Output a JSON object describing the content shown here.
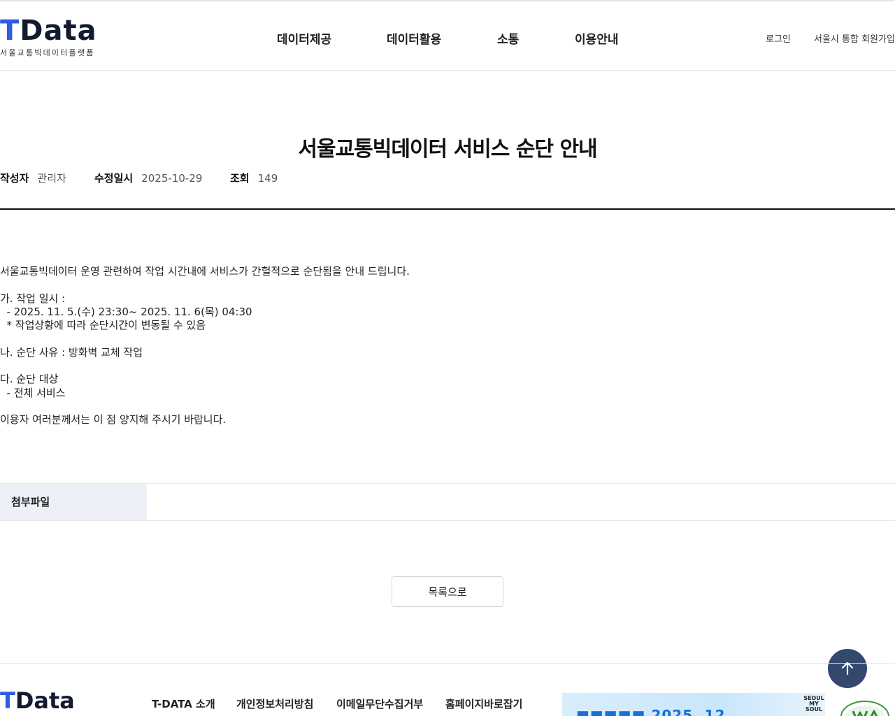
{
  "header": {
    "logo_t": "T",
    "logo_rest": "Data",
    "logo_sub": "서울교통빅데이터플랫폼",
    "nav": [
      "데이터제공",
      "데이터활용",
      "소통",
      "이용안내"
    ],
    "login": "로그인",
    "signup": "서울시 통합 회원가입"
  },
  "post": {
    "title": "서울교통빅데이터 서비스 순단 안내",
    "author_label": "작성자",
    "author": "관리자",
    "modified_label": "수정일시",
    "modified": "2025-10-29",
    "views_label": "조회",
    "views": "149",
    "body_lines": [
      "서울교통빅데이터 운영 관련하여 작업 시간내에 서비스가 간헐적으로 순단됨을 안내 드립니다.",
      "",
      "가. 작업 일시 :",
      "  - 2025. 11. 5.(수) 23:30~ 2025. 11. 6(목) 04:30",
      "  * 작업상황에 따라 순단시간이 변동될 수 있음",
      "",
      "나. 순단 사유 : 방화벽 교체 작업",
      "",
      "다. 순단 대상",
      "  - 전체 서비스",
      "",
      "이용자 여러분께서는 이 점 양지해 주시기 바랍니다."
    ],
    "attachment_label": "첨부파일",
    "list_button": "목록으로"
  },
  "footer": {
    "logo_t": "T",
    "logo_rest": "Data",
    "links": [
      "T-DATA 소개",
      "개인정보처리방침",
      "이메일무단수집거부",
      "홈페이지바로잡기"
    ],
    "banner_mark": "SEOUL MY SOUL"
  },
  "colors": {
    "brand_blue": "#2f5be4",
    "top_button": "#34486e",
    "attachment_bg": "#eef0f8"
  },
  "icons": {
    "top_button": "arrow-up-icon"
  }
}
